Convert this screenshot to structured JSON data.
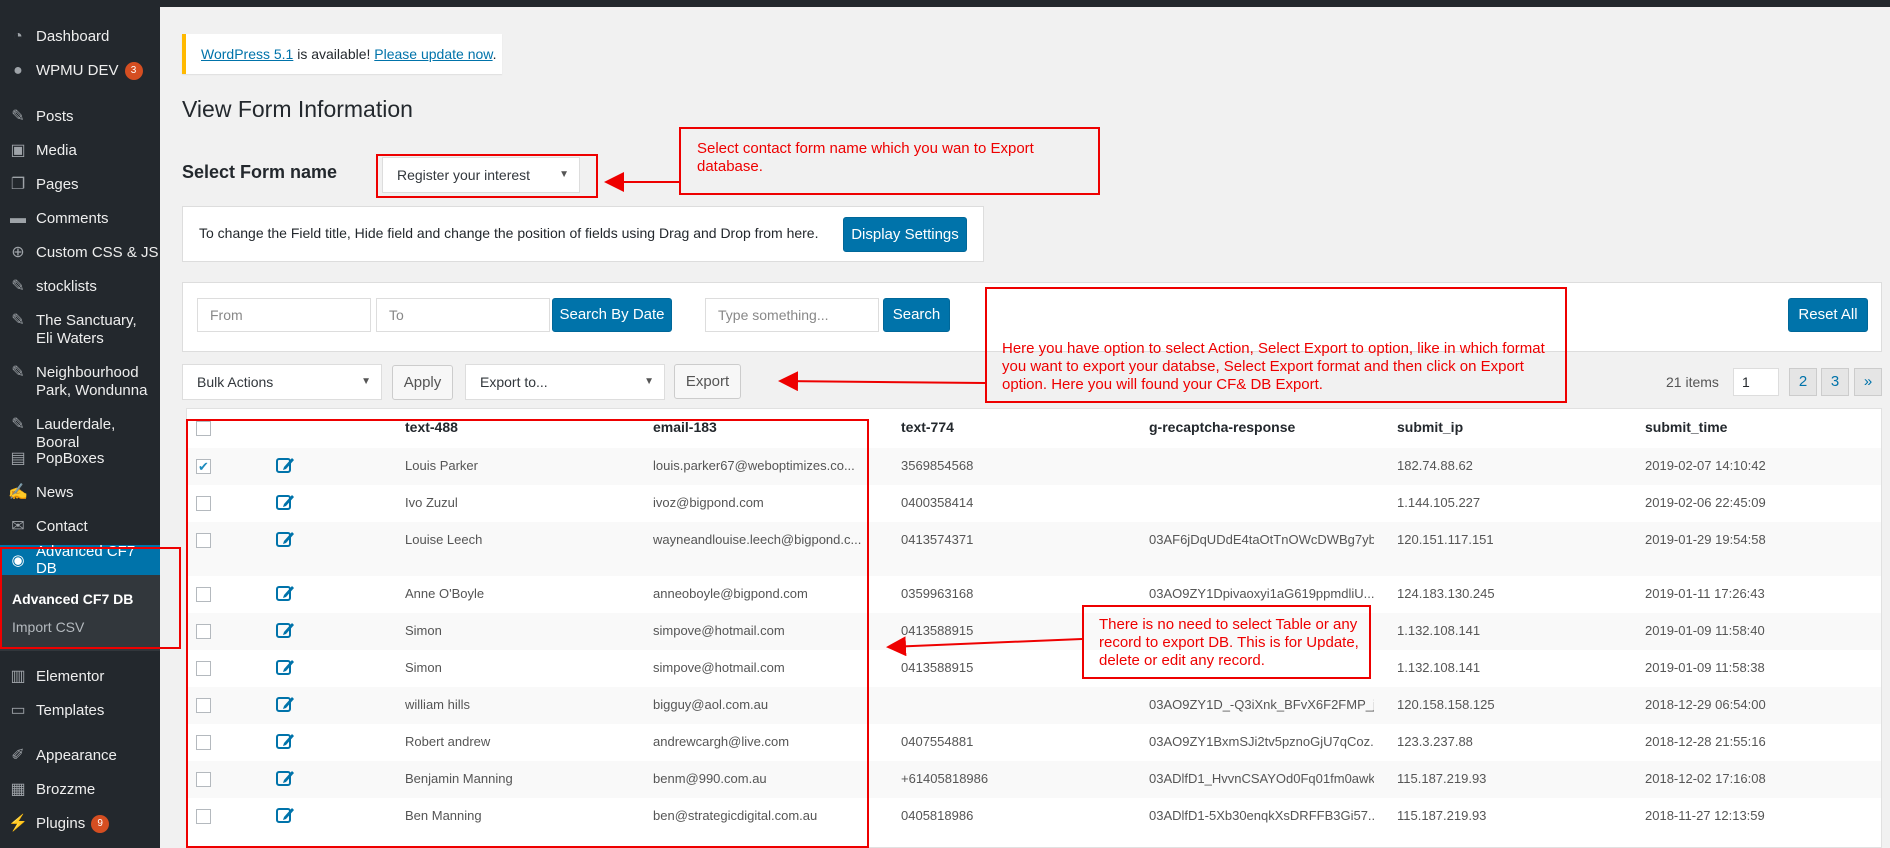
{
  "sidebar": {
    "items": [
      {
        "label": "Dashboard",
        "icon": "dashboard-icon"
      },
      {
        "label": "WPMU DEV",
        "icon": "wpmudev-icon",
        "badge": "3"
      },
      {
        "label": "Posts",
        "icon": "pin-icon"
      },
      {
        "label": "Media",
        "icon": "media-icon"
      },
      {
        "label": "Pages",
        "icon": "pages-icon"
      },
      {
        "label": "Comments",
        "icon": "comment-icon"
      },
      {
        "label": "Custom CSS & JS",
        "icon": "plus-circle-icon"
      },
      {
        "label": "stocklists",
        "icon": "pin-icon"
      },
      {
        "label": "The Sanctuary, Eli Waters",
        "icon": "pin-icon"
      },
      {
        "label": "Neighbourhood Park, Wondunna",
        "icon": "pin-icon"
      },
      {
        "label": "Lauderdale, Booral",
        "icon": "pin-icon"
      },
      {
        "label": "PopBoxes",
        "icon": "popbox-icon"
      },
      {
        "label": "News",
        "icon": "edit-icon"
      },
      {
        "label": "Contact",
        "icon": "mail-icon"
      },
      {
        "label": "Advanced CF7 DB",
        "icon": "eye-icon"
      },
      {
        "label": "Elementor",
        "icon": "elementor-icon"
      },
      {
        "label": "Templates",
        "icon": "folder-icon"
      },
      {
        "label": "Appearance",
        "icon": "brush-icon"
      },
      {
        "label": "Brozzme",
        "icon": "grid-icon"
      },
      {
        "label": "Plugins",
        "icon": "plugin-icon",
        "badge": "9"
      }
    ],
    "submenu": [
      "Advanced CF7 DB",
      "Import CSV"
    ]
  },
  "notice": {
    "link1": "WordPress 5.1",
    "middle": " is available! ",
    "link2": "Please update now",
    "end": "."
  },
  "page_title": "View Form Information",
  "select_form": {
    "label": "Select Form name",
    "value": "Register your interest"
  },
  "settings": {
    "text": "To change the Field title, Hide field and change the position of fields using Drag and Drop from here.",
    "button": "Display Settings"
  },
  "search": {
    "from_placeholder": "From",
    "to_placeholder": "To",
    "date_button": "Search By Date",
    "text_placeholder": "Type something...",
    "search_button": "Search",
    "reset_button": "Reset All"
  },
  "actions": {
    "bulk": "Bulk Actions",
    "apply": "Apply",
    "export_to": "Export to...",
    "export": "Export"
  },
  "pagination": {
    "items": "21 items",
    "current": "1",
    "pages": [
      "2",
      "3",
      "»"
    ]
  },
  "table": {
    "headers": [
      "text-488",
      "email-183",
      "text-774",
      "g-recaptcha-response",
      "submit_ip",
      "submit_time"
    ],
    "rows": [
      {
        "checked": true,
        "name": "Louis Parker",
        "email": "louis.parker67@weboptimizes.co...",
        "phone": "3569854568",
        "recaptcha": "",
        "ip": "182.74.88.62",
        "time": "2019-02-07 14:10:42"
      },
      {
        "checked": false,
        "name": "Ivo Zuzul",
        "email": "ivoz@bigpond.com",
        "phone": "0400358414",
        "recaptcha": "",
        "ip": "1.144.105.227",
        "time": "2019-02-06 22:45:09"
      },
      {
        "checked": false,
        "name": "Louise Leech",
        "email": "wayneandlouise.leech@bigpond.c...",
        "phone": "0413574371",
        "recaptcha": "03AF6jDqUDdE4taOtTnOWcDWBg7yb_..",
        "ip": "120.151.117.151",
        "time": "2019-01-29 19:54:58"
      },
      {
        "checked": false,
        "name": "Anne O'Boyle",
        "email": "anneoboyle@bigpond.com",
        "phone": "0359963168",
        "recaptcha": "03AO9ZY1Dpivaoxyi1aG619ppmdliU...",
        "ip": "124.183.130.245",
        "time": "2019-01-11 17:26:43"
      },
      {
        "checked": false,
        "name": "Simon",
        "email": "simpove@hotmail.com",
        "phone": "0413588915",
        "recaptcha": "",
        "ip": "1.132.108.141",
        "time": "2019-01-09 11:58:40"
      },
      {
        "checked": false,
        "name": "Simon",
        "email": "simpove@hotmail.com",
        "phone": "0413588915",
        "recaptcha": "",
        "ip": "1.132.108.141",
        "time": "2019-01-09 11:58:38"
      },
      {
        "checked": false,
        "name": "william hills",
        "email": "bigguy@aol.com.au",
        "phone": "",
        "recaptcha": "03AO9ZY1D_-Q3iXnk_BFvX6F2FMP_j...",
        "ip": "120.158.158.125",
        "time": "2018-12-29 06:54:00"
      },
      {
        "checked": false,
        "name": "Robert andrew",
        "email": "andrewcargh@live.com",
        "phone": "0407554881",
        "recaptcha": "03AO9ZY1BxmSJi2tv5pznoGjU7qCoz...",
        "ip": "123.3.237.88",
        "time": "2018-12-28 21:55:16"
      },
      {
        "checked": false,
        "name": "Benjamin Manning",
        "email": "benm@990.com.au",
        "phone": "+61405818986",
        "recaptcha": "03ADlfD1_HvvnCSAYOd0Fq01fm0awk...",
        "ip": "115.187.219.93",
        "time": "2018-12-02 17:16:08"
      },
      {
        "checked": false,
        "name": "Ben Manning",
        "email": "ben@strategicdigital.com.au",
        "phone": "0405818986",
        "recaptcha": "03ADlfD1-5Xb30enqkXsDRFFB3Gi57...",
        "ip": "115.187.219.93",
        "time": "2018-11-27 12:13:59"
      }
    ]
  },
  "annotations": {
    "form_name": "Select contact form name which you wan to Export database.",
    "export": "Here you have option to select Action, Select Export to option, like in which format you want to export your databse, Select Export format and then click on Export option. Here you will found your CF& DB Export.",
    "records": "There is no need to select Table  or any record to export DB. This is for Update, delete or edit any record.",
    "color": "#ee0000"
  },
  "colors": {
    "accent": "#0073aa",
    "sidebar": "#23282d",
    "annotation": "#ee0000"
  }
}
